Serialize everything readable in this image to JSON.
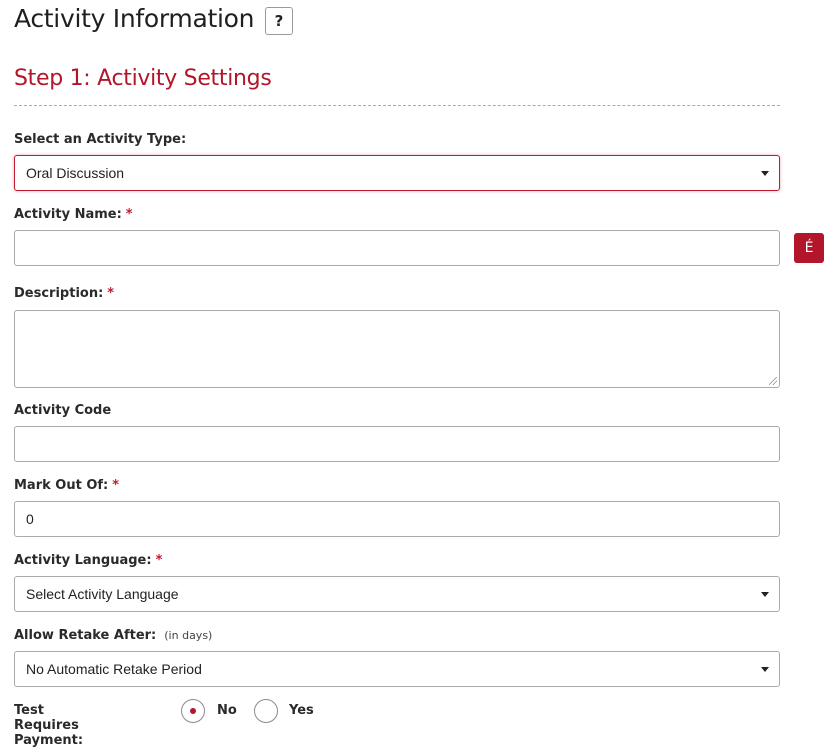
{
  "header": {
    "title": "Activity Information",
    "help_label": "?"
  },
  "step": {
    "title": "Step 1: Activity Settings"
  },
  "form": {
    "activity_type": {
      "label": "Select an Activity Type:",
      "selected": "Oral Discussion"
    },
    "activity_name": {
      "label": "Activity Name:",
      "required_mark": "*",
      "value": "",
      "accent_button_label": "É"
    },
    "description": {
      "label": "Description:",
      "required_mark": "*",
      "value": ""
    },
    "activity_code": {
      "label": "Activity Code",
      "value": ""
    },
    "mark_out_of": {
      "label": "Mark Out Of:",
      "required_mark": "*",
      "value": "0"
    },
    "activity_language": {
      "label": "Activity Language:",
      "required_mark": "*",
      "selected": "Select Activity Language"
    },
    "allow_retake": {
      "label": "Allow Retake After:",
      "hint": "(in days)",
      "selected": "No Automatic Retake Period"
    },
    "test_requires_payment": {
      "label": "Test Requires Payment:",
      "options": [
        {
          "label": "No",
          "checked": true
        },
        {
          "label": "Yes",
          "checked": false
        }
      ]
    }
  },
  "colors": {
    "accent": "#b3152b",
    "focus_border": "#c01b32"
  }
}
